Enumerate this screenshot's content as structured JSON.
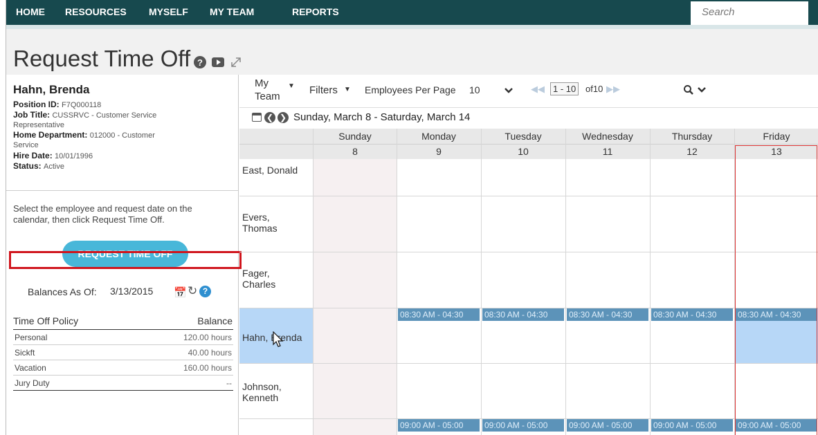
{
  "nav": {
    "items": [
      "HOME",
      "RESOURCES",
      "MYSELF",
      "MY TEAM",
      "REPORTS"
    ],
    "search_placeholder": "Search"
  },
  "page": {
    "title": "Request Time Off",
    "icons": [
      "help-icon",
      "video-icon",
      "expand-icon"
    ]
  },
  "employee": {
    "name": "Hahn, Brenda",
    "position_id_label": "Position ID:",
    "position_id": "F7Q000118",
    "job_title_label": "Job Title:",
    "job_title": "CUSSRVC - Customer Service Representative",
    "job_title_line1": "CUSSRVC - Customer Service",
    "job_title_line2": "Representative",
    "home_dept_label": "Home Department:",
    "home_dept_line1": "012000 - Customer",
    "home_dept_line2": "Service",
    "hire_date_label": "Hire Date:",
    "hire_date": "10/01/1996",
    "status_label": "Status:",
    "status": "Active"
  },
  "instructions": "Select the employee and request date on the calendar, then click Request Time Off.",
  "request_button": "REQUEST TIME OFF",
  "balances": {
    "label": "Balances As Of:",
    "date": "3/13/2015",
    "policy_header": "Time Off Policy",
    "balance_header": "Balance",
    "rows": [
      {
        "policy": "Personal",
        "balance": "120.00 hours"
      },
      {
        "policy": "Sickft",
        "balance": "40.00 hours"
      },
      {
        "policy": "Vacation",
        "balance": "160.00 hours"
      },
      {
        "policy": "Jury Duty",
        "balance": "--"
      }
    ]
  },
  "toolbar": {
    "my": "My",
    "team": "Team",
    "filters": "Filters",
    "per_page_label": "Employees Per Page",
    "per_page": "10",
    "range": "1 - 10",
    "of": "of10"
  },
  "week": {
    "range": "Sunday, March 8 - Saturday, March 14",
    "days": [
      {
        "name": "Sunday",
        "num": "8"
      },
      {
        "name": "Monday",
        "num": "9"
      },
      {
        "name": "Tuesday",
        "num": "10"
      },
      {
        "name": "Wednesday",
        "num": "11"
      },
      {
        "name": "Thursday",
        "num": "12"
      },
      {
        "name": "Friday",
        "num": "13"
      }
    ]
  },
  "employees": [
    {
      "name1": "East, Donald",
      "name2": ""
    },
    {
      "name1": "Evers,",
      "name2": "Thomas"
    },
    {
      "name1": "Fager,",
      "name2": "Charles"
    },
    {
      "name1": "Hahn, Brenda",
      "name2": ""
    },
    {
      "name1": "Johnson,",
      "name2": "Kenneth"
    },
    {
      "name1": "",
      "name2": ""
    }
  ],
  "shifts": {
    "hahn": "08:30 AM - 04:30",
    "last": "09:00 AM - 05:00"
  },
  "colors": {
    "nav_bg": "#17494e",
    "button": "#48b7d9",
    "selected_row": "#b7d7f7",
    "shift": "#5c93b9",
    "highlight": "#d0141c"
  }
}
